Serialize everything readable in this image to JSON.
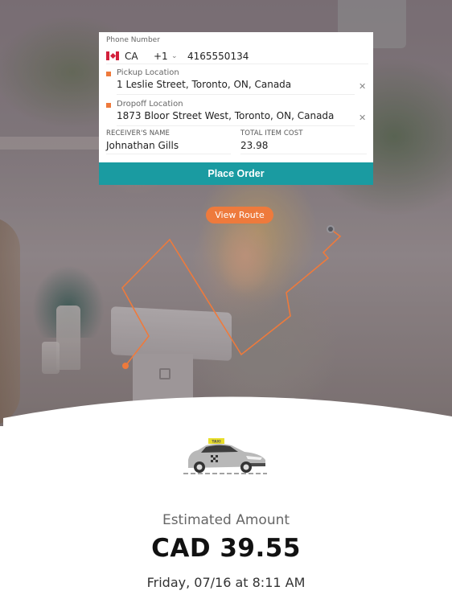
{
  "form": {
    "phone": {
      "label": "Phone Number",
      "country_flag": "canada-flag-icon",
      "country_code": "CA",
      "dial_code": "+1",
      "dropdown_icon": "chevron-down-icon",
      "number": "4165550134"
    },
    "pickup": {
      "label": "Pickup Location",
      "value": "1 Leslie Street, Toronto, ON, Canada",
      "clear_icon": "close-icon"
    },
    "dropoff": {
      "label": "Dropoff Location",
      "value": "1873 Bloor Street West, Toronto, ON, Canada",
      "clear_icon": "close-icon"
    },
    "receiver": {
      "label": "RECEIVER'S NAME",
      "value": "Johnathan Gills"
    },
    "item_cost": {
      "label": "TOTAL ITEM COST",
      "value": "23.98"
    },
    "place_order_label": "Place Order"
  },
  "map": {
    "view_route_label": "View Route",
    "route_color": "#ee7a3c"
  },
  "estimate": {
    "vehicle_icon": "taxi-icon",
    "label": "Estimated Amount",
    "amount": "CAD 39.55",
    "time": "Friday, 07/16 at 8:11 AM"
  },
  "colors": {
    "primary": "#1a9ba1",
    "accent": "#ee7a3c"
  }
}
